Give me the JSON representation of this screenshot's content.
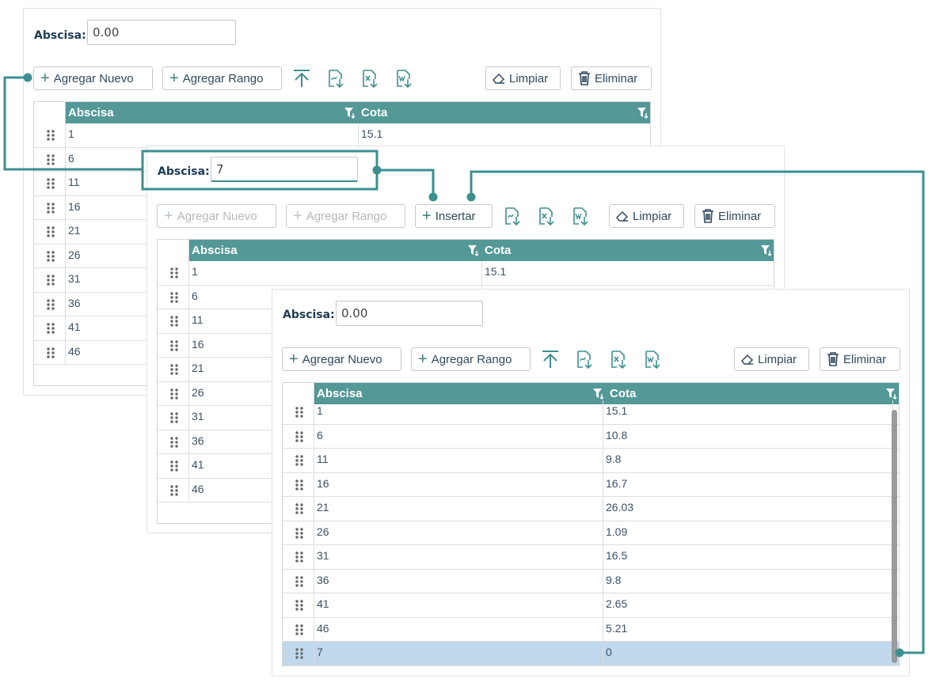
{
  "abscisa_label": "Abscisa:",
  "panel1": {
    "abscisa_value": "0.00",
    "btn_agregar_nuevo": "Agregar Nuevo",
    "btn_agregar_rango": "Agregar Rango",
    "btn_limpiar": "Limpiar",
    "btn_eliminar": "Eliminar",
    "col_abscisa": "Abscisa",
    "col_cota": "Cota",
    "rows": [
      {
        "abscisa": "1",
        "cota": "15.1"
      },
      {
        "abscisa": "6",
        "cota": ""
      },
      {
        "abscisa": "11",
        "cota": ""
      },
      {
        "abscisa": "16",
        "cota": ""
      },
      {
        "abscisa": "21",
        "cota": ""
      },
      {
        "abscisa": "26",
        "cota": ""
      },
      {
        "abscisa": "31",
        "cota": ""
      },
      {
        "abscisa": "36",
        "cota": ""
      },
      {
        "abscisa": "41",
        "cota": ""
      },
      {
        "abscisa": "46",
        "cota": ""
      }
    ]
  },
  "panel2": {
    "abscisa_value": "7",
    "btn_agregar_nuevo": "Agregar Nuevo",
    "btn_agregar_rango": "Agregar Rango",
    "btn_insertar": "Insertar",
    "btn_limpiar": "Limpiar",
    "btn_eliminar": "Eliminar",
    "col_abscisa": "Abscisa",
    "col_cota": "Cota",
    "rows": [
      {
        "abscisa": "1",
        "cota": "15.1"
      },
      {
        "abscisa": "6",
        "cota": ""
      },
      {
        "abscisa": "11",
        "cota": ""
      },
      {
        "abscisa": "16",
        "cota": ""
      },
      {
        "abscisa": "21",
        "cota": ""
      },
      {
        "abscisa": "26",
        "cota": ""
      },
      {
        "abscisa": "31",
        "cota": ""
      },
      {
        "abscisa": "36",
        "cota": ""
      },
      {
        "abscisa": "41",
        "cota": ""
      },
      {
        "abscisa": "46",
        "cota": ""
      }
    ]
  },
  "panel3": {
    "abscisa_value": "0.00",
    "btn_agregar_nuevo": "Agregar Nuevo",
    "btn_agregar_rango": "Agregar Rango",
    "btn_limpiar": "Limpiar",
    "btn_eliminar": "Eliminar",
    "col_abscisa": "Abscisa",
    "col_cota": "Cota",
    "rows": [
      {
        "abscisa": "1",
        "cota": "15.1"
      },
      {
        "abscisa": "6",
        "cota": "10.8"
      },
      {
        "abscisa": "11",
        "cota": "9.8"
      },
      {
        "abscisa": "16",
        "cota": "16.7"
      },
      {
        "abscisa": "21",
        "cota": "26.03"
      },
      {
        "abscisa": "26",
        "cota": "1.09"
      },
      {
        "abscisa": "31",
        "cota": "16.5"
      },
      {
        "abscisa": "36",
        "cota": "9.8"
      },
      {
        "abscisa": "41",
        "cota": "2.65"
      },
      {
        "abscisa": "46",
        "cota": "5.21"
      },
      {
        "abscisa": "7",
        "cota": "0"
      }
    ],
    "selected_row": 10
  },
  "colors": {
    "header": "#549898",
    "accent": "#3d8f8f",
    "selected_row": "#bfd8ec",
    "connector": "#3d8f8f"
  }
}
